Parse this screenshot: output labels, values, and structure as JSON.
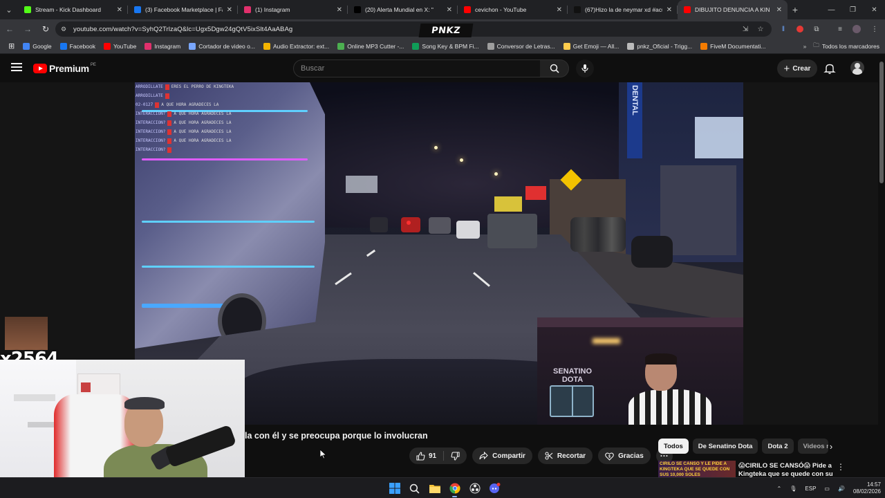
{
  "browser": {
    "tabs": [
      {
        "title": "Stream - Kick Dashboard",
        "icon": "kick-icon",
        "color": "#53fc18",
        "active": false
      },
      {
        "title": "(3) Facebook Marketplace | Fac",
        "icon": "facebook-icon",
        "color": "#1877f2",
        "active": false
      },
      {
        "title": "(1) Instagram",
        "icon": "instagram-icon",
        "color": "#e1306c",
        "active": false
      },
      {
        "title": "(20) Alerta Mundial en X: \"",
        "icon": "x-icon",
        "color": "#000000",
        "active": false
      },
      {
        "title": "cevichon - YouTube",
        "icon": "youtube-icon",
        "color": "#ff0000",
        "active": false
      },
      {
        "title": "(67)Hizo la de neymar xd #acu",
        "icon": "tiktok-icon",
        "color": "#111111",
        "active": false
      },
      {
        "title": "DIBUJITO DENUNCIA A KIN",
        "icon": "youtube-icon",
        "color": "#ff0000",
        "active": true
      }
    ],
    "url": "youtube.com/watch?v=SyhQ2TrlzaQ&lc=Ugx5Dgw24gQtV5ixSlt4AaABAg",
    "overlay_logo": "PNKZ",
    "bookmarks": [
      {
        "label": "Google",
        "icon": "google-icon",
        "color": "#4285f4"
      },
      {
        "label": "Facebook",
        "icon": "facebook-icon",
        "color": "#1877f2"
      },
      {
        "label": "YouTube",
        "icon": "youtube-icon",
        "color": "#ff0000"
      },
      {
        "label": "Instagram",
        "icon": "instagram-icon",
        "color": "#e1306c"
      },
      {
        "label": "Cortador de video o...",
        "icon": "scissors-icon",
        "color": "#7aa7ff"
      },
      {
        "label": "Audio Extractor: ext...",
        "icon": "audio-icon",
        "color": "#f4b400"
      },
      {
        "label": "Online MP3 Cutter -...",
        "icon": "mp3-icon",
        "color": "#4caf50"
      },
      {
        "label": "Song Key & BPM Fi...",
        "icon": "music-icon",
        "color": "#0f9d58"
      },
      {
        "label": "Conversor de Letras...",
        "icon": "letters-icon",
        "color": "#9e9e9e"
      },
      {
        "label": "Get Emoji — All...",
        "icon": "emoji-icon",
        "color": "#ffcc4d"
      },
      {
        "label": "pnkz_Oficial - Trigg...",
        "icon": "doc-icon",
        "color": "#bbbbbb"
      },
      {
        "label": "FiveM Documentati...",
        "icon": "fivem-icon",
        "color": "#f57c00"
      }
    ],
    "all_bookmarks": "Todos los marcadores"
  },
  "youtube": {
    "brand": "Premium",
    "country": "PE",
    "search_placeholder": "Buscar",
    "create_label": "Crear",
    "video_title": "la con él y se preocupa porque lo involucran",
    "likes": "91",
    "share_label": "Compartir",
    "clip_label": "Recortar",
    "thanks_label": "Gracias",
    "chips": [
      "Todos",
      "De Senatino Dota",
      "Dota 2",
      "Videos r"
    ],
    "reco": {
      "thumb_text": "CIRILO SE CANSO Y LE PIDE A KINGTEKA QUE SE QUEDE CON SUS 10,000 SOLES",
      "title": "😱CIRILO SE CANSÓ😱 Pide a Kingteka que se quede con su"
    }
  },
  "stream_overlay": {
    "chat": [
      {
        "user": "ARRODILLATE",
        "msg": "ERES EL PERRO DE KINGTEKA"
      },
      {
        "user": "ARRODILLATE",
        "msg": ""
      },
      {
        "user": "02-0127",
        "msg": "A QUE HORA AGRADECES LA"
      },
      {
        "user": "INTERACCION?",
        "msg": "A QUE HORA AGRADECES LA"
      },
      {
        "user": "INTERACCION?",
        "msg": "A QUE HORA AGRADECES LA"
      },
      {
        "user": "INTERACCION?",
        "msg": "A QUE HORA AGRADECES LA"
      },
      {
        "user": "INTERACCION?",
        "msg": "A QUE HORA AGRADECES LA"
      },
      {
        "user": "INTERACCION?",
        "msg": ""
      }
    ],
    "viewer_label": "x2564",
    "pip_brand": "SENATINO DOTA",
    "street_sign": "DENTAL"
  },
  "taskbar": {
    "lang": "ESP",
    "time": "14:57",
    "date": "08/02/2026"
  }
}
